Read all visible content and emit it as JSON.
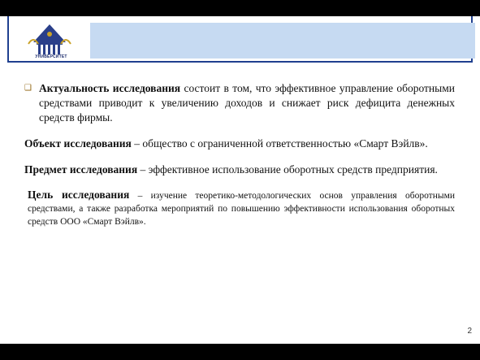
{
  "header": {
    "logo_text": "УНИВЕРСИТЕТ"
  },
  "content": {
    "actuality": {
      "term": "Актуальность исследования",
      "text": " состоит в том, что эффективное управление оборотными средствами приводит к увеличению доходов и снижает риск дефицита денежных средств фирмы."
    },
    "object": {
      "term": "Объект исследования",
      "text": " – общество с ограниченной ответственностью «Смарт Вэйлв»."
    },
    "subject": {
      "term": "Предмет исследования",
      "text": " – эффективное использование оборотных средств предприятия."
    },
    "goal": {
      "term": "Цель исследования",
      "text": " – изучение теоретико-методологических основ управления оборотными средствами, а также разработка мероприятий по повышению эффективности использования оборотных средств ООО «Смарт Вэйлв»."
    }
  },
  "footer": {
    "page_number": "2"
  },
  "colors": {
    "frame": "#1f3f8f",
    "title_band": "#c6daf2",
    "background": "#000000"
  }
}
